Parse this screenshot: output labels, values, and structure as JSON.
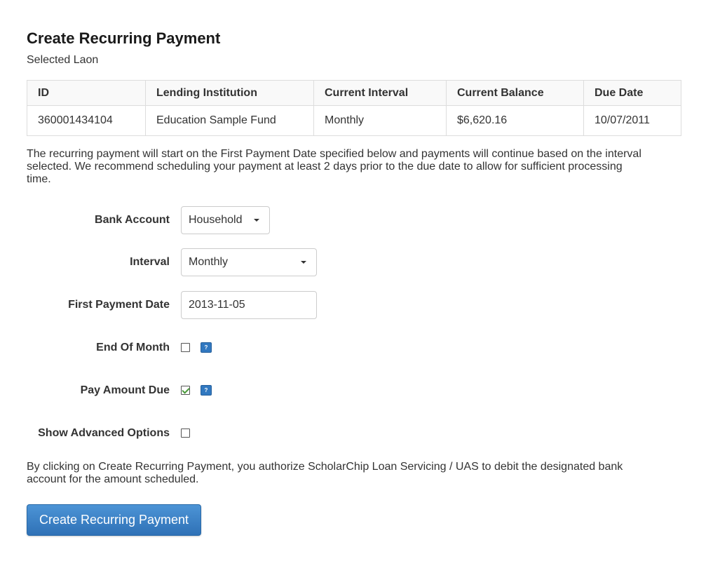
{
  "page": {
    "title": "Create Recurring Payment",
    "subtitle": "Selected Laon"
  },
  "loan_table": {
    "headers": [
      "ID",
      "Lending Institution",
      "Current Interval",
      "Current Balance",
      "Due Date"
    ],
    "rows": [
      [
        "360001434104",
        "Education Sample Fund",
        "Monthly",
        "$6,620.16",
        "10/07/2011"
      ]
    ]
  },
  "notice_text": "The recurring payment will start on the First Payment Date specified below and payments will continue based on the interval selected. We recommend scheduling your payment at least 2 days prior to the due date to allow for sufficient processing time.",
  "form": {
    "bank_account": {
      "label": "Bank Account",
      "value": "Household"
    },
    "interval": {
      "label": "Interval",
      "value": "Monthly"
    },
    "first_payment_date": {
      "label": "First Payment Date",
      "value": "2013-11-05"
    },
    "end_of_month": {
      "label": "End Of Month",
      "checked": false,
      "help": "?"
    },
    "pay_amount_due": {
      "label": "Pay Amount Due",
      "checked": true,
      "help": "?"
    },
    "show_advanced_options": {
      "label": "Show Advanced Options",
      "checked": false
    }
  },
  "authorization_text": "By clicking on Create Recurring Payment, you authorize ScholarChip Loan Servicing / UAS to debit the designated bank account for the amount scheduled.",
  "submit_label": "Create Recurring Payment",
  "colors": {
    "primary_button": "#3178c0",
    "help_icon": "#3178c0",
    "check_mark": "#4a9a3a"
  },
  "icons": {
    "select_caret": "chevron-down-icon",
    "help": "help-icon",
    "check": "check-icon"
  }
}
